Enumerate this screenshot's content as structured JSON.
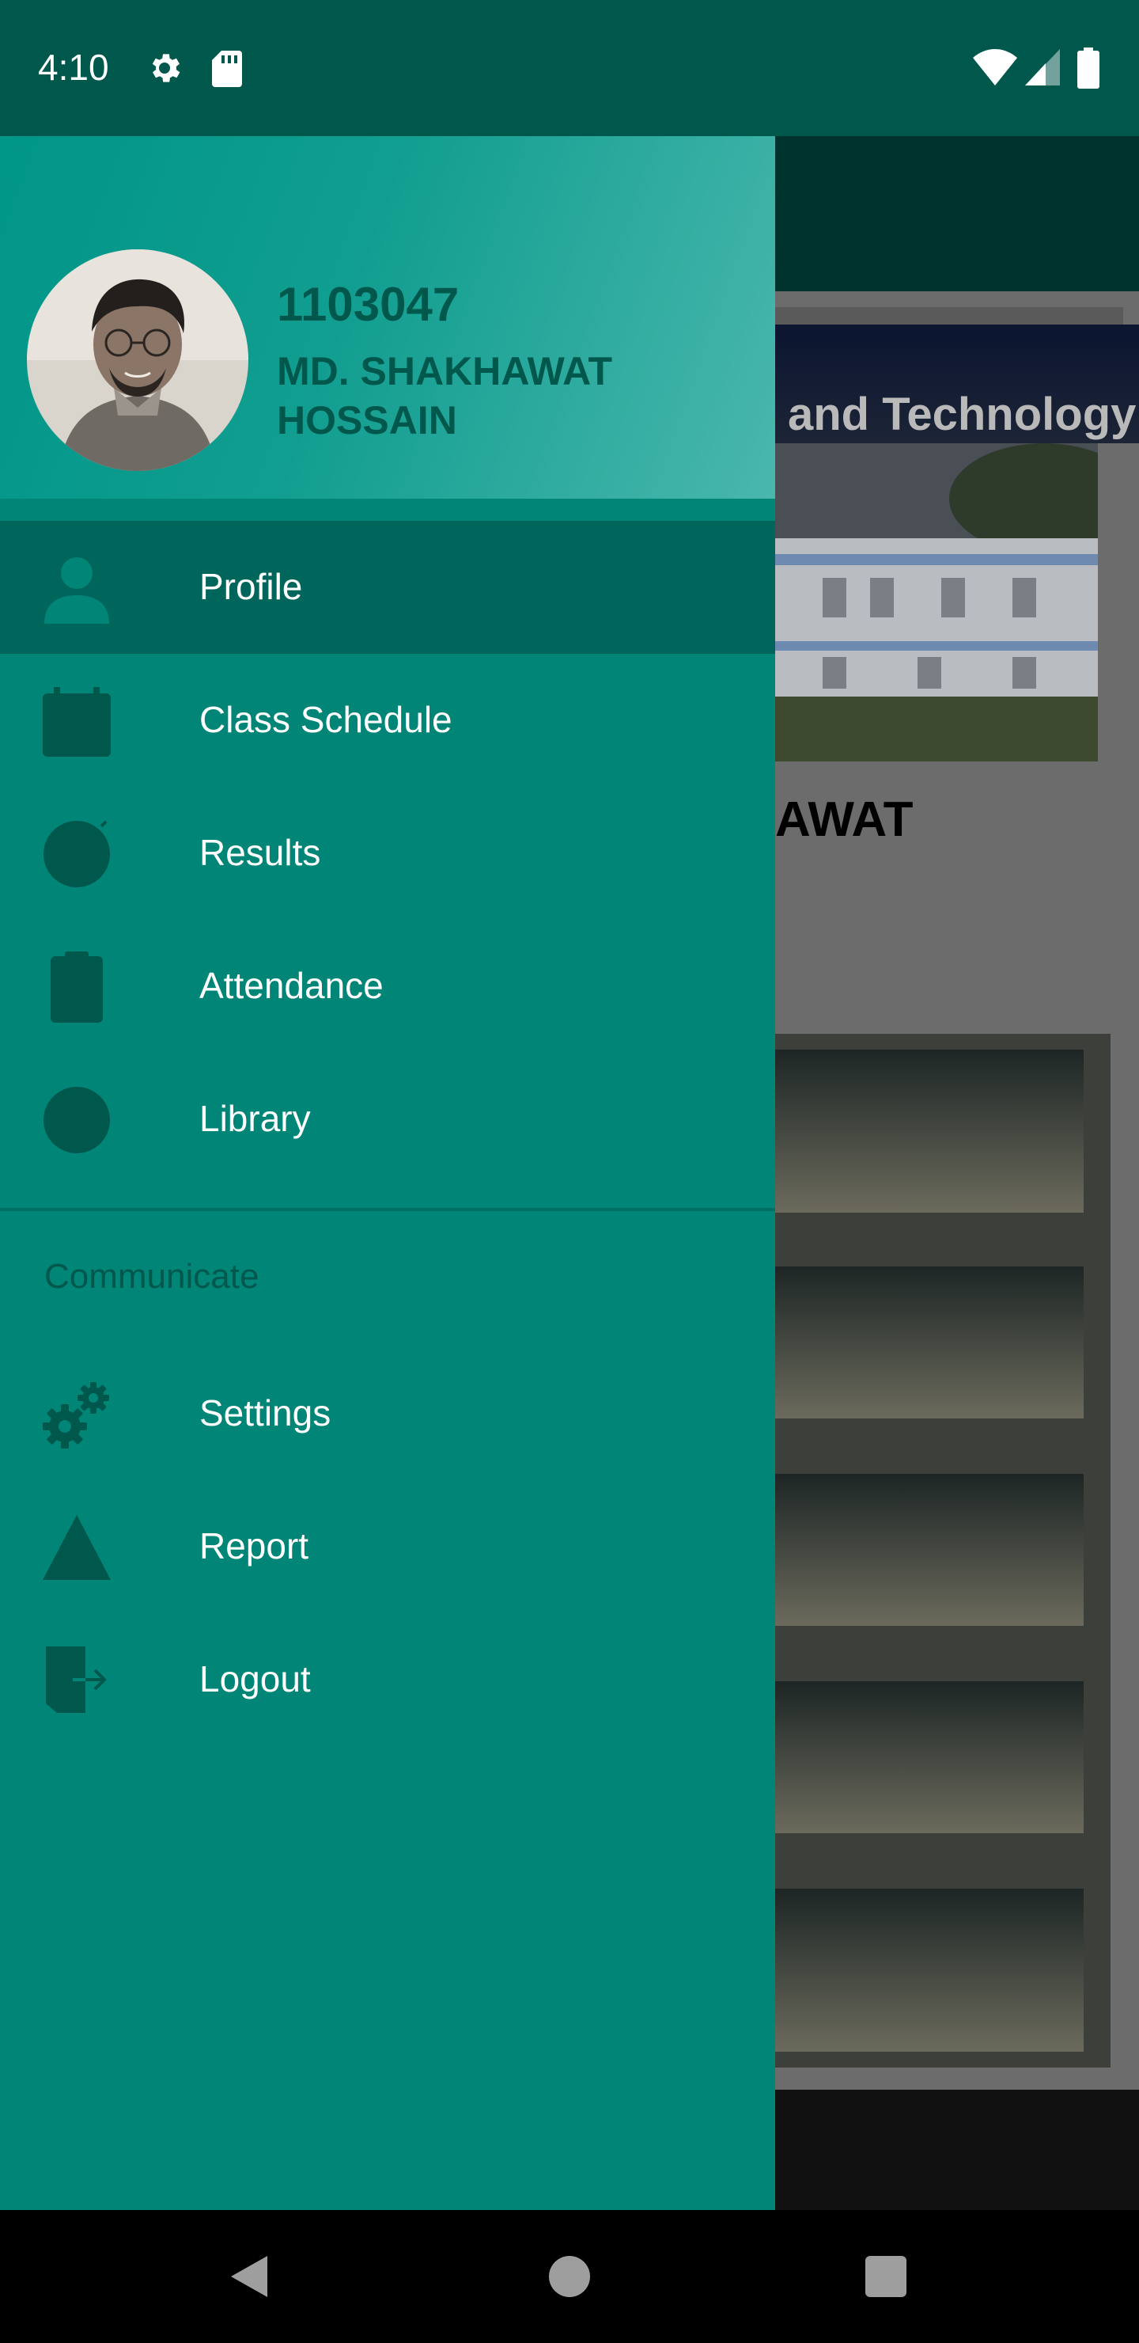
{
  "status_bar": {
    "time": "4:10",
    "icons": [
      "gear-icon",
      "sd-card-icon",
      "wifi-icon",
      "cell-signal-icon",
      "battery-icon"
    ]
  },
  "background_app": {
    "banner_text": "and Technology",
    "name_partial": "AWAT"
  },
  "drawer": {
    "header": {
      "id": "1103047",
      "name": "MD. SHAKHAWAT HOSSAIN"
    },
    "items": [
      {
        "label": "Profile",
        "icon": "person-icon",
        "active": true
      },
      {
        "label": "Class Schedule",
        "icon": "calendar-icon",
        "active": false
      },
      {
        "label": "Results",
        "icon": "results-icon",
        "active": false
      },
      {
        "label": "Attendance",
        "icon": "clipboard-icon",
        "active": false
      },
      {
        "label": "Library",
        "icon": "library-icon",
        "active": false
      }
    ],
    "section_title": "Communicate",
    "communicate_items": [
      {
        "label": "Settings",
        "icon": "settings-icon"
      },
      {
        "label": "Report",
        "icon": "report-icon"
      },
      {
        "label": "Logout",
        "icon": "logout-icon"
      }
    ]
  },
  "colors": {
    "status_bar": "#00574c",
    "drawer": "#008577",
    "active_item": "#00665b",
    "header_text": "#00574c",
    "icon": "#00574c"
  }
}
